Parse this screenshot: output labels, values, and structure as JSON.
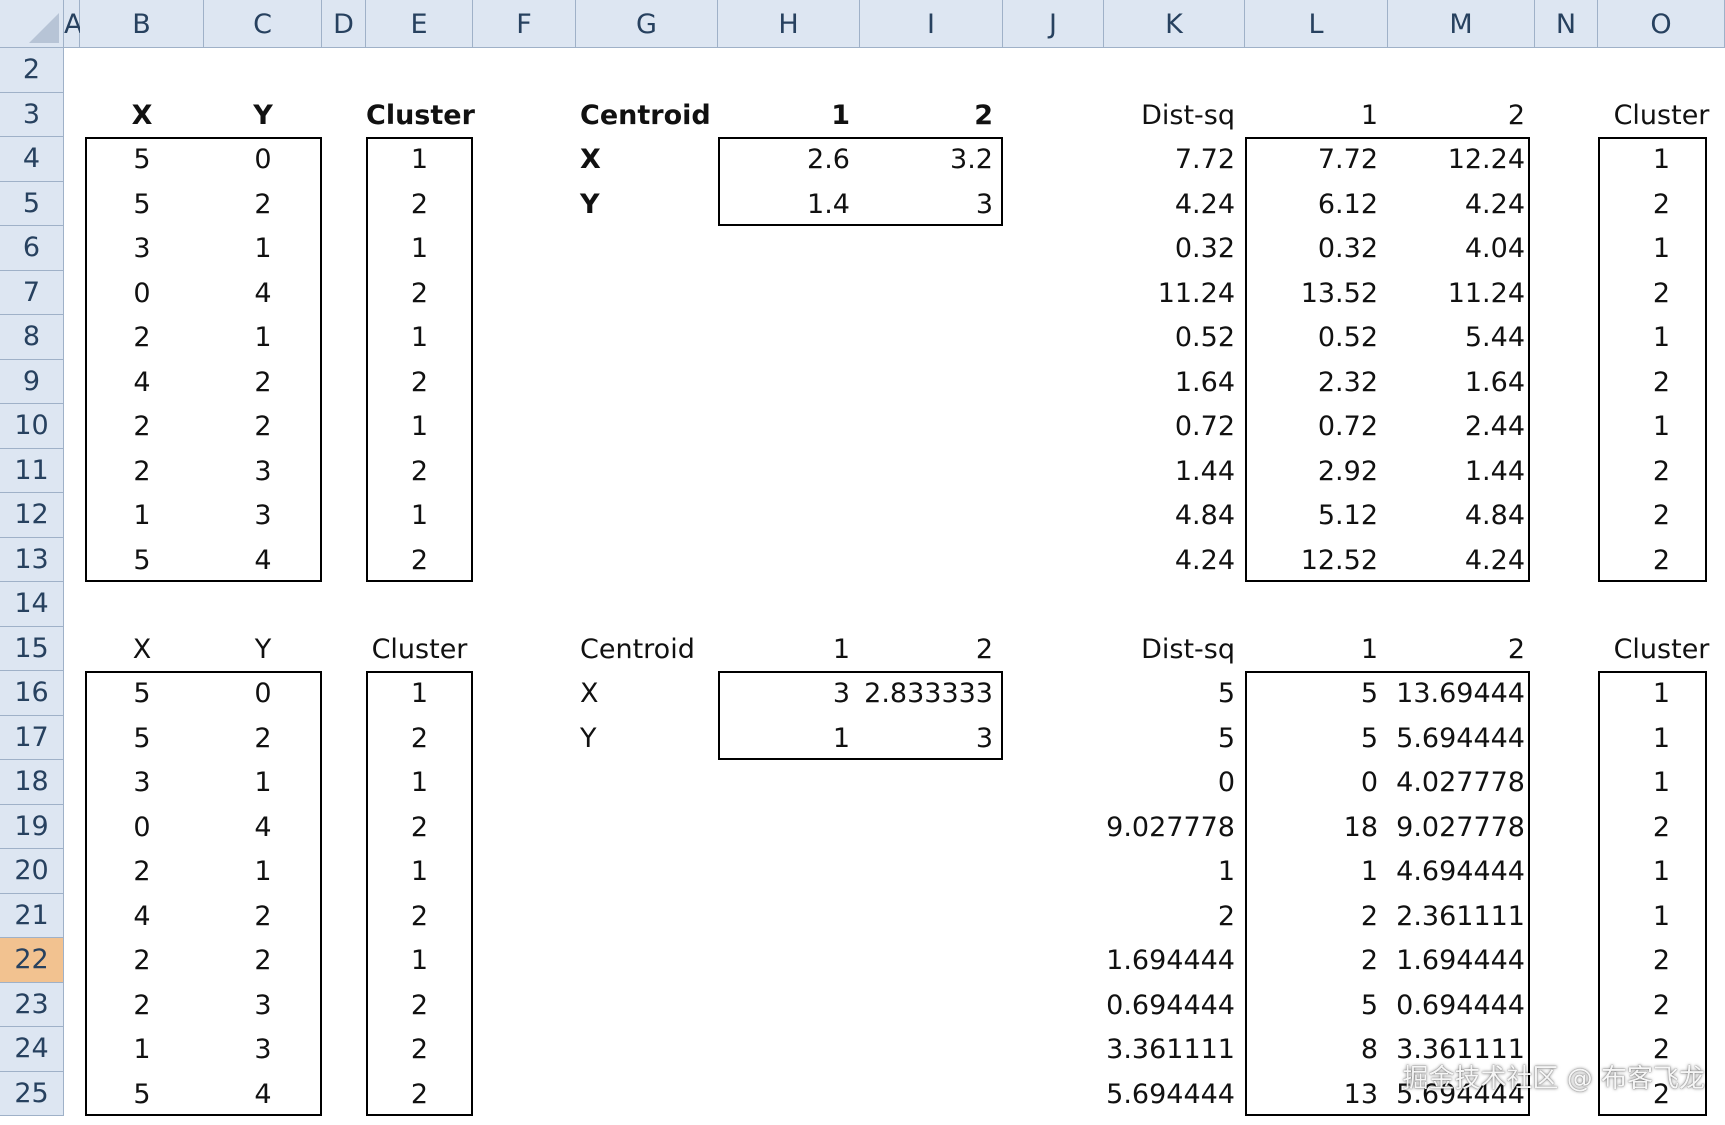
{
  "columns": [
    "A",
    "B",
    "C",
    "D",
    "E",
    "F",
    "G",
    "H",
    "I",
    "J",
    "K",
    "L",
    "M",
    "N",
    "O"
  ],
  "rows": [
    "2",
    "3",
    "4",
    "5",
    "6",
    "7",
    "8",
    "9",
    "10",
    "11",
    "12",
    "13",
    "14",
    "15",
    "16",
    "17",
    "18",
    "19",
    "20",
    "21",
    "22",
    "23",
    "24",
    "25"
  ],
  "selected_row": "22",
  "block1": {
    "hdr_x": "X",
    "hdr_y": "Y",
    "hdr_cluster": "Cluster",
    "points": [
      [
        "5",
        "0"
      ],
      [
        "5",
        "2"
      ],
      [
        "3",
        "1"
      ],
      [
        "0",
        "4"
      ],
      [
        "2",
        "1"
      ],
      [
        "4",
        "2"
      ],
      [
        "2",
        "2"
      ],
      [
        "2",
        "3"
      ],
      [
        "1",
        "3"
      ],
      [
        "5",
        "4"
      ]
    ],
    "clusters": [
      "1",
      "2",
      "1",
      "2",
      "1",
      "2",
      "1",
      "2",
      "1",
      "2"
    ],
    "centroid_label": "Centroid",
    "c1": "1",
    "c2": "2",
    "cx_label": "X",
    "cy_label": "Y",
    "centroids": {
      "x1": "2.6",
      "x2": "3.2",
      "y1": "1.4",
      "y2": "3"
    },
    "dist_label": "Dist-sq",
    "d1": "1",
    "d2": "2",
    "cluster2_label": "Cluster",
    "dist_min": [
      "7.72",
      "4.24",
      "0.32",
      "11.24",
      "0.52",
      "1.64",
      "0.72",
      "1.44",
      "4.84",
      "4.24"
    ],
    "dist1": [
      "7.72",
      "6.12",
      "0.32",
      "13.52",
      "0.52",
      "2.32",
      "0.72",
      "2.92",
      "5.12",
      "12.52"
    ],
    "dist2": [
      "12.24",
      "4.24",
      "4.04",
      "11.24",
      "5.44",
      "1.64",
      "2.44",
      "1.44",
      "4.84",
      "4.24"
    ],
    "assigned": [
      "1",
      "2",
      "1",
      "2",
      "1",
      "2",
      "1",
      "2",
      "2",
      "2"
    ]
  },
  "block2": {
    "hdr_x": "X",
    "hdr_y": "Y",
    "hdr_cluster": "Cluster",
    "points": [
      [
        "5",
        "0"
      ],
      [
        "5",
        "2"
      ],
      [
        "3",
        "1"
      ],
      [
        "0",
        "4"
      ],
      [
        "2",
        "1"
      ],
      [
        "4",
        "2"
      ],
      [
        "2",
        "2"
      ],
      [
        "2",
        "3"
      ],
      [
        "1",
        "3"
      ],
      [
        "5",
        "4"
      ]
    ],
    "clusters": [
      "1",
      "2",
      "1",
      "2",
      "1",
      "2",
      "1",
      "2",
      "2",
      "2"
    ],
    "centroid_label": "Centroid",
    "c1": "1",
    "c2": "2",
    "cx_label": "X",
    "cy_label": "Y",
    "centroids": {
      "x1": "3",
      "x2": "2.833333",
      "y1": "1",
      "y2": "3"
    },
    "dist_label": "Dist-sq",
    "d1": "1",
    "d2": "2",
    "cluster2_label": "Cluster",
    "dist_min": [
      "5",
      "5",
      "0",
      "9.027778",
      "1",
      "2",
      "1.694444",
      "0.694444",
      "3.361111",
      "5.694444"
    ],
    "dist1": [
      "5",
      "5",
      "0",
      "18",
      "1",
      "2",
      "2",
      "5",
      "8",
      "13"
    ],
    "dist2": [
      "13.69444",
      "5.694444",
      "4.027778",
      "9.027778",
      "4.694444",
      "2.361111",
      "1.694444",
      "0.694444",
      "3.361111",
      "5.694444"
    ],
    "assigned": [
      "1",
      "1",
      "1",
      "2",
      "1",
      "1",
      "2",
      "2",
      "2",
      "2"
    ]
  },
  "watermark": "掘金技术社区 @ 布客飞龙"
}
